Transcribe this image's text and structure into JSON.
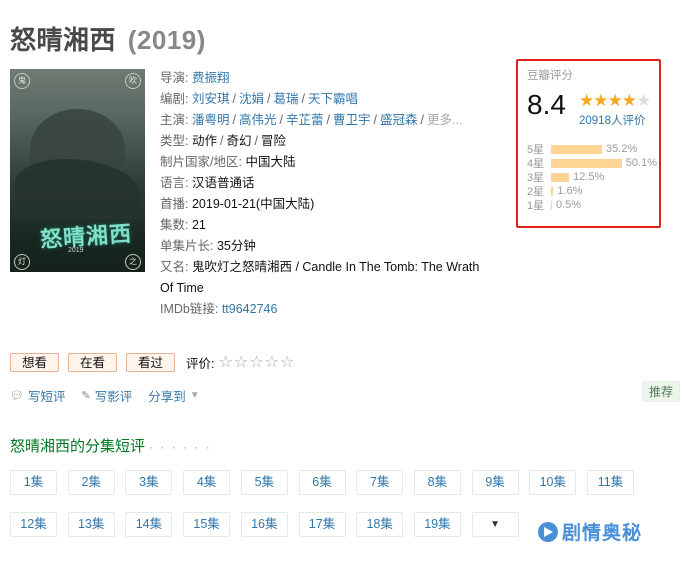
{
  "title": {
    "name": "怒晴湘西",
    "year": "(2019)"
  },
  "info": {
    "director_label": "导演:",
    "director": "费振翔",
    "writer_label": "编剧:",
    "writers": [
      "刘安琪",
      "沈娟",
      "葛瑞",
      "天下霸唱"
    ],
    "cast_label": "主演:",
    "cast": [
      "潘粤明",
      "高伟光",
      "辛芷蕾",
      "曹卫宇",
      "盛冠森"
    ],
    "cast_more": "更多...",
    "genre_label": "类型:",
    "genres": [
      "动作",
      "奇幻",
      "冒险"
    ],
    "country_label": "制片国家/地区:",
    "country": "中国大陆",
    "language_label": "语言:",
    "language": "汉语普通话",
    "premiere_label": "首播:",
    "premiere": "2019-01-21(中国大陆)",
    "episodes_label": "集数:",
    "episodes": "21",
    "runtime_label": "单集片长:",
    "runtime": "35分钟",
    "aka_label": "又名:",
    "aka_line1": "鬼吹灯之怒晴湘西 / Candle In The Tomb: The Wrath",
    "aka_line2": "Of Time",
    "imdb_label": "IMDb链接:",
    "imdb": "tt9642746"
  },
  "poster": {
    "seal_tl": "鬼",
    "seal_tr": "吹",
    "seal_bl": "灯",
    "seal_br": "之",
    "title": "怒晴湘西",
    "subtitle": "2019"
  },
  "rating": {
    "title": "豆瓣评分",
    "score": "8.4",
    "stars_on": 4,
    "people": "20918人评价",
    "distribution": [
      {
        "label": "5星",
        "pct": "35.2%",
        "value": 35.2
      },
      {
        "label": "4星",
        "pct": "50.1%",
        "value": 50.1
      },
      {
        "label": "3星",
        "pct": "12.5%",
        "value": 12.5
      },
      {
        "label": "2星",
        "pct": "1.6%",
        "value": 1.6
      },
      {
        "label": "1星",
        "pct": "0.5%",
        "value": 0.5
      }
    ]
  },
  "actions": {
    "want": "想看",
    "watching": "在看",
    "watched": "看过",
    "rate_label": "评价:"
  },
  "share": {
    "short_review": "写短评",
    "review": "写影评",
    "share": "分享到"
  },
  "tag": "推荐",
  "episodes_section": {
    "title": "怒晴湘西的分集短评",
    "dots": "· · · · · ·",
    "episodes": [
      "1集",
      "2集",
      "3集",
      "4集",
      "5集",
      "6集",
      "7集",
      "8集",
      "9集",
      "10集",
      "11集",
      "12集",
      "13集",
      "14集",
      "15集",
      "16集",
      "17集",
      "18集",
      "19集"
    ],
    "more": "▼"
  },
  "watermark": "剧情奥秘",
  "colors": {
    "link": "#3377aa",
    "green": "#007722",
    "star": "#f5a623",
    "bar": "#ffd596",
    "highlight": "#e0231a"
  }
}
